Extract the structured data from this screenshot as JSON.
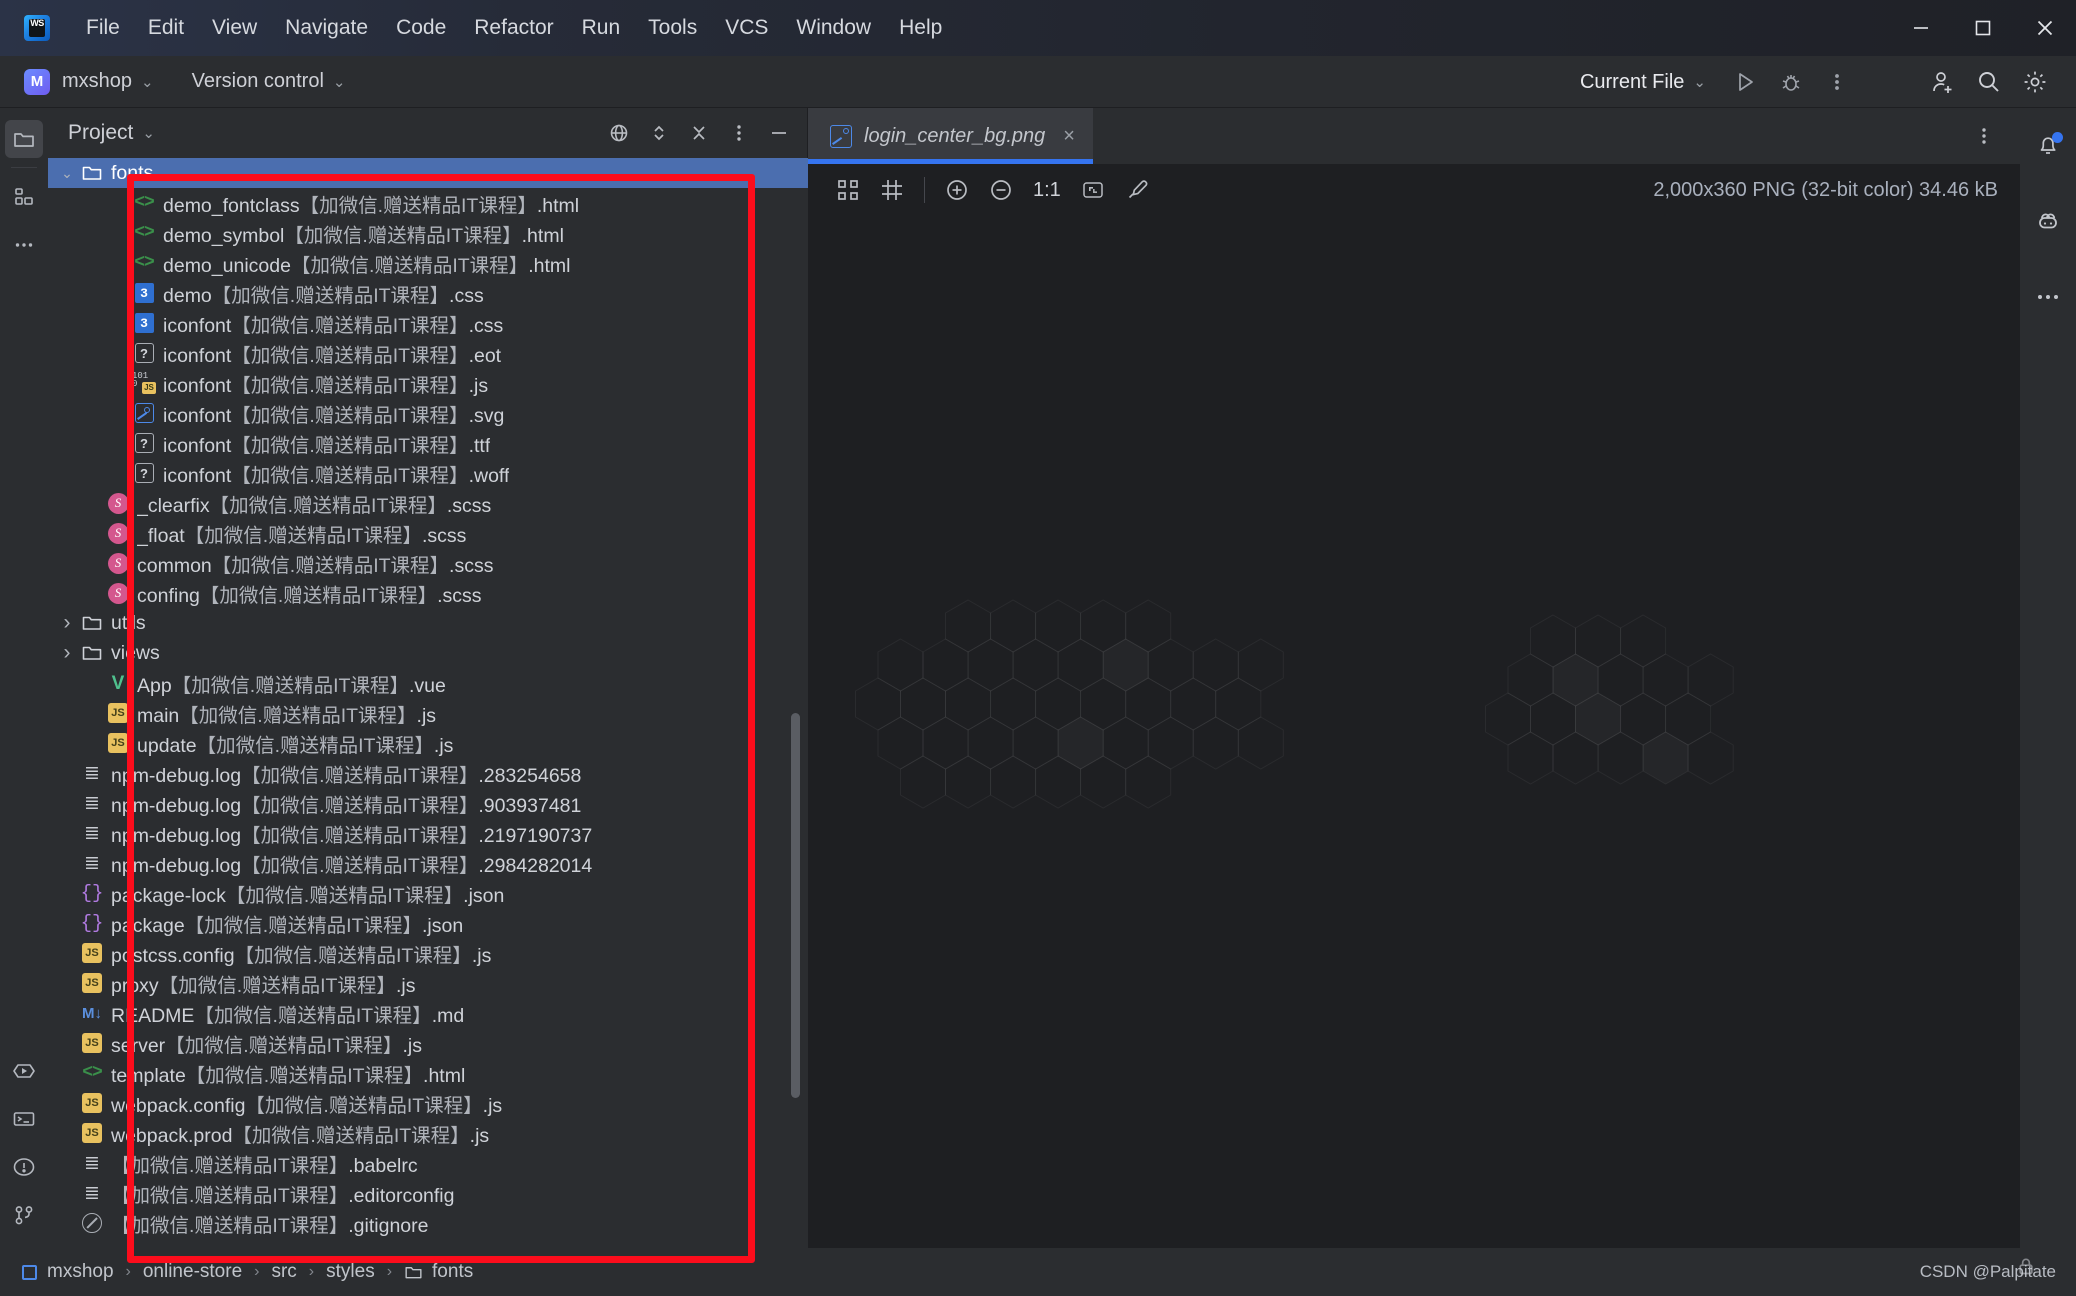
{
  "window": {
    "app_icon": "webstorm-logo-icon",
    "menu": [
      "File",
      "Edit",
      "View",
      "Navigate",
      "Code",
      "Refactor",
      "Run",
      "Tools",
      "VCS",
      "Window",
      "Help"
    ],
    "controls": [
      "minimize-icon",
      "maximize-icon",
      "close-icon"
    ]
  },
  "toolbar": {
    "project_badge": "M",
    "project_name": "mxshop",
    "vcs_label": "Version control",
    "run_config": "Current File",
    "icons": [
      "run-icon",
      "debug-icon",
      "more-vertical-icon",
      "add-user-icon",
      "search-icon",
      "settings-icon"
    ]
  },
  "left_activity_bar": {
    "items": [
      {
        "name": "project-icon",
        "selected": true
      },
      {
        "name": "structure-icon",
        "selected": false
      },
      {
        "name": "more-tools-icon",
        "selected": false
      },
      {
        "name": "run-tool-icon",
        "selected": false
      },
      {
        "name": "terminal-icon",
        "selected": false
      },
      {
        "name": "problems-icon",
        "selected": false
      },
      {
        "name": "version-control-icon",
        "selected": false
      }
    ]
  },
  "right_activity_bar": {
    "items": [
      "notifications-icon",
      "ai-assistant-icon",
      "more-tools-icon"
    ],
    "notification_dot": true
  },
  "project_panel": {
    "title": "Project",
    "actions": [
      "locate-icon",
      "expand-collapse-icon",
      "collapse-all-icon",
      "options-icon",
      "hide-icon"
    ],
    "tree": [
      {
        "label": "fonts",
        "cn": "",
        "ext": "",
        "icon": "folder-open-icon",
        "indent": 1,
        "arrow": "down",
        "selected": true
      },
      {
        "label": "demo_fontclass",
        "cn": "【加微信.赠送精品IT课程】",
        "ext": ".html",
        "icon": "html-icon",
        "indent": 3
      },
      {
        "label": "demo_symbol",
        "cn": "【加微信.赠送精品IT课程】",
        "ext": ".html",
        "icon": "html-icon",
        "indent": 3
      },
      {
        "label": "demo_unicode",
        "cn": "【加微信.赠送精品IT课程】",
        "ext": ".html",
        "icon": "html-icon",
        "indent": 3
      },
      {
        "label": "demo",
        "cn": "【加微信.赠送精品IT课程】",
        "ext": ".css",
        "icon": "css-icon",
        "indent": 3
      },
      {
        "label": "iconfont",
        "cn": "【加微信.赠送精品IT课程】",
        "ext": ".css",
        "icon": "css-icon",
        "indent": 3
      },
      {
        "label": "iconfont",
        "cn": "【加微信.赠送精品IT课程】",
        "ext": ".eot",
        "icon": "unknown-file-icon",
        "indent": 3
      },
      {
        "label": "iconfont",
        "cn": "【加微信.赠送精品IT课程】",
        "ext": ".js",
        "icon": "js-binary-icon",
        "indent": 3
      },
      {
        "label": "iconfont",
        "cn": "【加微信.赠送精品IT课程】",
        "ext": ".svg",
        "icon": "image-icon",
        "indent": 3
      },
      {
        "label": "iconfont",
        "cn": "【加微信.赠送精品IT课程】",
        "ext": ".ttf",
        "icon": "unknown-file-icon",
        "indent": 3
      },
      {
        "label": "iconfont",
        "cn": "【加微信.赠送精品IT课程】",
        "ext": ".woff",
        "icon": "unknown-file-icon",
        "indent": 3
      },
      {
        "label": "_clearfix",
        "cn": "【加微信.赠送精品IT课程】",
        "ext": ".scss",
        "icon": "scss-icon",
        "indent": 2
      },
      {
        "label": "_float",
        "cn": "【加微信.赠送精品IT课程】",
        "ext": ".scss",
        "icon": "scss-icon",
        "indent": 2
      },
      {
        "label": "common",
        "cn": "【加微信.赠送精品IT课程】",
        "ext": ".scss",
        "icon": "scss-icon",
        "indent": 2
      },
      {
        "label": "confing",
        "cn": "【加微信.赠送精品IT课程】",
        "ext": ".scss",
        "icon": "scss-icon",
        "indent": 2
      },
      {
        "label": "utils",
        "cn": "",
        "ext": "",
        "icon": "folder-icon",
        "indent": 1,
        "arrow": "right"
      },
      {
        "label": "views",
        "cn": "",
        "ext": "",
        "icon": "folder-icon",
        "indent": 1,
        "arrow": "right"
      },
      {
        "label": "App",
        "cn": "【加微信.赠送精品IT课程】",
        "ext": ".vue",
        "icon": "vue-icon",
        "indent": 2
      },
      {
        "label": "main",
        "cn": "【加微信.赠送精品IT课程】",
        "ext": ".js",
        "icon": "js-icon",
        "indent": 2
      },
      {
        "label": "update",
        "cn": "【加微信.赠送精品IT课程】",
        "ext": ".js",
        "icon": "js-icon",
        "indent": 2
      },
      {
        "label": "npm-debug.log",
        "cn": "【加微信.赠送精品IT课程】",
        "ext": ".283254658",
        "icon": "log-icon",
        "indent": 1
      },
      {
        "label": "npm-debug.log",
        "cn": "【加微信.赠送精品IT课程】",
        "ext": ".903937481",
        "icon": "log-icon",
        "indent": 1
      },
      {
        "label": "npm-debug.log",
        "cn": "【加微信.赠送精品IT课程】",
        "ext": ".2197190737",
        "icon": "log-icon",
        "indent": 1
      },
      {
        "label": "npm-debug.log",
        "cn": "【加微信.赠送精品IT课程】",
        "ext": ".2984282014",
        "icon": "log-icon",
        "indent": 1
      },
      {
        "label": "package-lock",
        "cn": "【加微信.赠送精品IT课程】",
        "ext": ".json",
        "icon": "json-icon",
        "indent": 1
      },
      {
        "label": "package",
        "cn": "【加微信.赠送精品IT课程】",
        "ext": ".json",
        "icon": "json-icon",
        "indent": 1
      },
      {
        "label": "postcss.config",
        "cn": "【加微信.赠送精品IT课程】",
        "ext": ".js",
        "icon": "js-icon",
        "indent": 1
      },
      {
        "label": "proxy",
        "cn": "【加微信.赠送精品IT课程】",
        "ext": ".js",
        "icon": "js-icon",
        "indent": 1
      },
      {
        "label": "README",
        "cn": "【加微信.赠送精品IT课程】",
        "ext": ".md",
        "icon": "markdown-icon",
        "indent": 1
      },
      {
        "label": "server",
        "cn": "【加微信.赠送精品IT课程】",
        "ext": ".js",
        "icon": "js-icon",
        "indent": 1
      },
      {
        "label": "template",
        "cn": "【加微信.赠送精品IT课程】",
        "ext": ".html",
        "icon": "html-icon",
        "indent": 1
      },
      {
        "label": "webpack.config",
        "cn": "【加微信.赠送精品IT课程】",
        "ext": ".js",
        "icon": "js-icon",
        "indent": 1
      },
      {
        "label": "webpack.prod",
        "cn": "【加微信.赠送精品IT课程】",
        "ext": ".js",
        "icon": "js-icon",
        "indent": 1
      },
      {
        "label": "",
        "cn": "【加微信.赠送精品IT课程】",
        "ext": ".babelrc",
        "icon": "log-icon",
        "indent": 1
      },
      {
        "label": "",
        "cn": "【加微信.赠送精品IT课程】",
        "ext": ".editorconfig",
        "icon": "log-icon",
        "indent": 1
      },
      {
        "label": "",
        "cn": "【加微信.赠送精品IT课程】",
        "ext": ".gitignore",
        "icon": "ignore-icon",
        "indent": 1
      }
    ]
  },
  "editor": {
    "tab": {
      "label": "login_center_bg.png",
      "icon": "image-file-icon",
      "close": "×"
    },
    "tab_actions": [
      "more-vertical-icon"
    ],
    "image_toolbar": {
      "icons": [
        "toggle-transparency-icon",
        "toggle-grid-icon",
        "zoom-in-icon",
        "zoom-out-icon",
        "actual-size-icon",
        "fit-content-icon",
        "color-picker-icon"
      ],
      "zoom_label": "1:1"
    },
    "image_info": "2,000x360 PNG (32-bit color) 34.46 kB"
  },
  "status_bar": {
    "breadcrumb": [
      "mxshop",
      "online-store",
      "src",
      "styles",
      "fonts"
    ],
    "watermark": "CSDN @Palpitate"
  },
  "colors": {
    "accent": "#3574f0",
    "selection": "#4b6eaf",
    "annotation": "#fc0d1c",
    "panel_bg": "#2b2d30",
    "editor_bg": "#1e1f22"
  }
}
